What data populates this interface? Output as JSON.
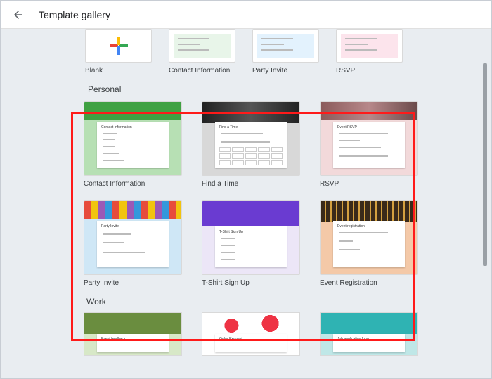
{
  "header": {
    "title": "Template gallery"
  },
  "top_row": [
    {
      "label": "Blank"
    },
    {
      "label": "Contact Information"
    },
    {
      "label": "Party Invite"
    },
    {
      "label": "RSVP"
    }
  ],
  "sections": {
    "personal": {
      "title": "Personal",
      "row1": [
        {
          "label": "Contact Information"
        },
        {
          "label": "Find a Time"
        },
        {
          "label": "RSVP"
        }
      ],
      "row2": [
        {
          "label": "Party Invite"
        },
        {
          "label": "T-Shirt Sign Up"
        },
        {
          "label": "Event Registration"
        }
      ]
    },
    "work": {
      "title": "Work"
    }
  },
  "thumb_titles": {
    "contact": "Contact Information",
    "findtime": "Find a Time",
    "rsvp": "Event RSVP",
    "party": "Party Invite",
    "tshirt": "T-Shirt Sign Up",
    "eventreg": "Event registration",
    "feedback": "Event feedback",
    "order": "Order Request",
    "jobapp": "Job application form"
  }
}
